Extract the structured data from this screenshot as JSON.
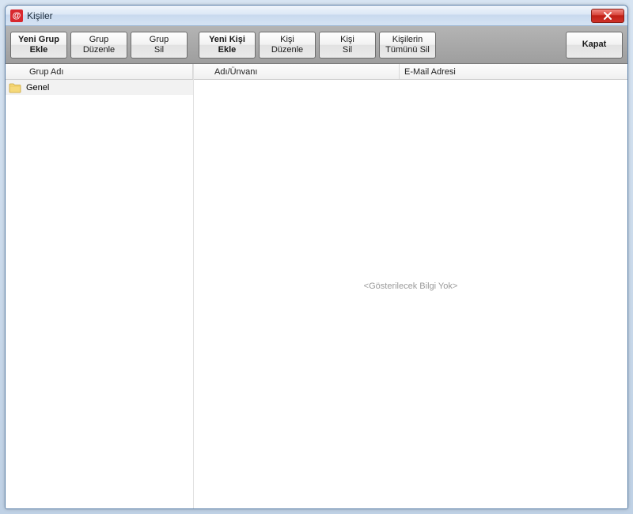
{
  "window": {
    "title": "Kişiler"
  },
  "toolbar": {
    "new_group": "Yeni Grup\nEkle",
    "edit_group": "Grup\nDüzenle",
    "del_group": "Grup\nSil",
    "new_person": "Yeni Kişi\nEkle",
    "edit_person": "Kişi\nDüzenle",
    "del_person": "Kişi\nSil",
    "del_all_persons": "Kişilerin\nTümünü Sil",
    "close": "Kapat"
  },
  "columns": {
    "group_name": "Grup Adı",
    "name_title": "Adı/Ünvanı",
    "email": "E-Mail Adresi"
  },
  "groups": [
    {
      "name": "Genel"
    }
  ],
  "people_panel": {
    "empty_message": "<Gösterilecek Bilgi Yok>"
  }
}
